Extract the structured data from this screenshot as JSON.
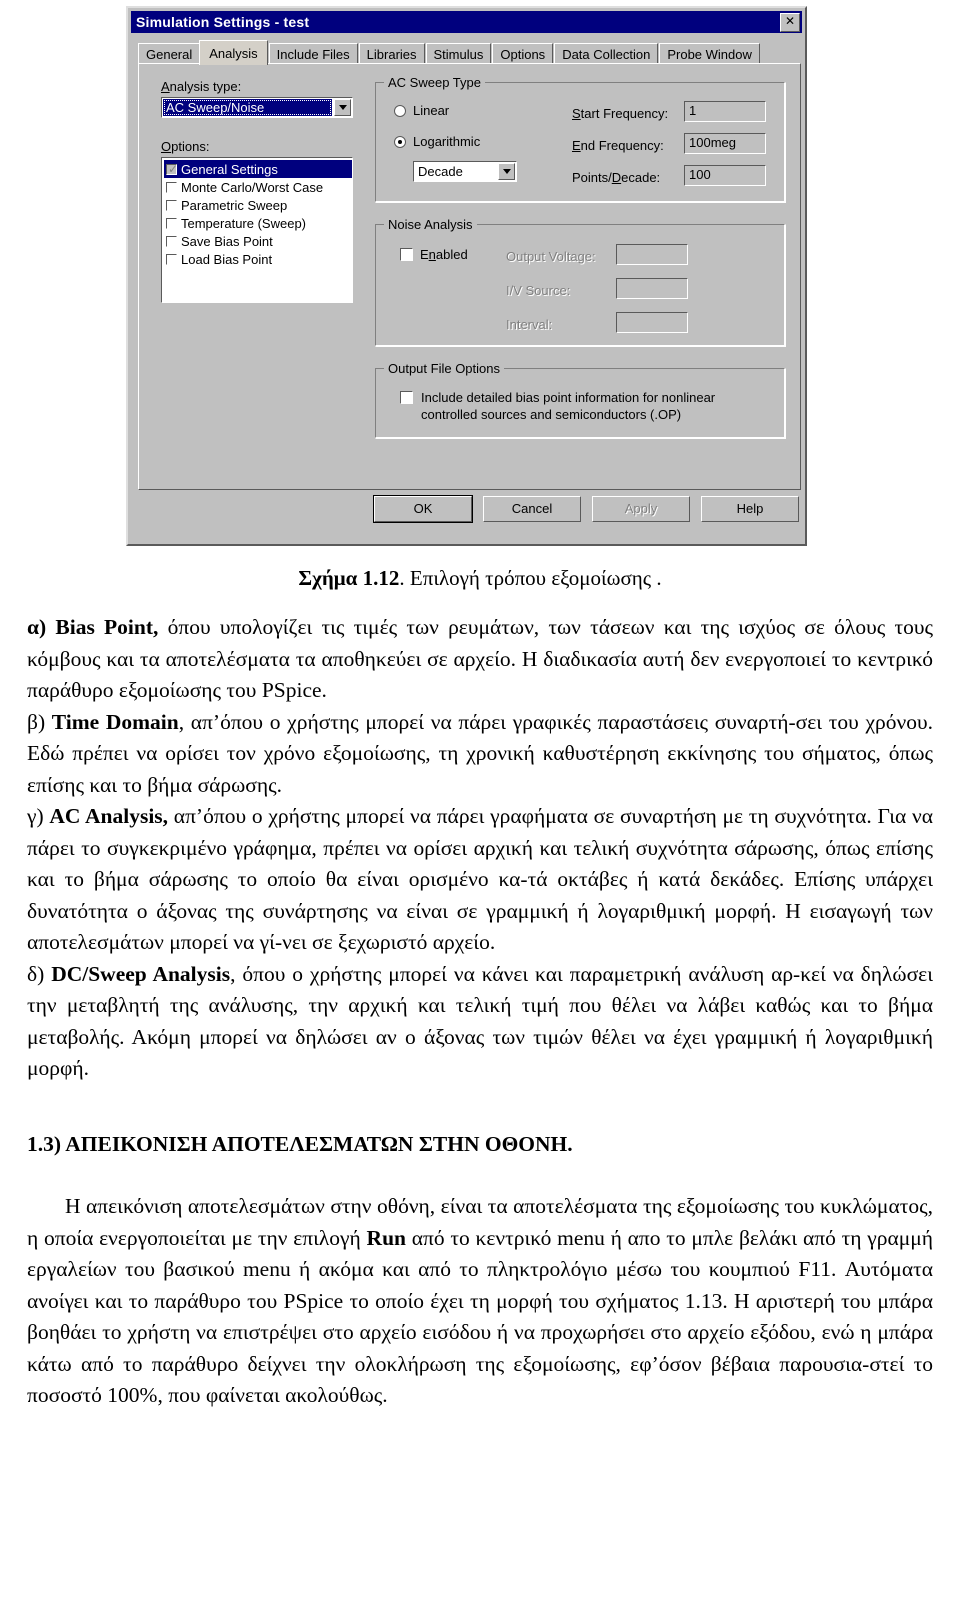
{
  "dialog": {
    "title": "Simulation Settings - test",
    "close_label": "✕",
    "tabs": [
      {
        "label": "General",
        "active": false
      },
      {
        "label": "Analysis",
        "active": true
      },
      {
        "label": "Include Files",
        "active": false
      },
      {
        "label": "Libraries",
        "active": false
      },
      {
        "label": "Stimulus",
        "active": false
      },
      {
        "label": "Options",
        "active": false
      },
      {
        "label": "Data Collection",
        "active": false
      },
      {
        "label": "Probe Window",
        "active": false
      }
    ],
    "analysis_type_label": "Analysis type:",
    "analysis_type_value": "AC Sweep/Noise",
    "options_label": "Options:",
    "options": [
      {
        "label": "General Settings",
        "checked": true,
        "selected": true
      },
      {
        "label": "Monte Carlo/Worst Case",
        "checked": false,
        "selected": false
      },
      {
        "label": "Parametric Sweep",
        "checked": false,
        "selected": false
      },
      {
        "label": "Temperature (Sweep)",
        "checked": false,
        "selected": false
      },
      {
        "label": "Save Bias Point",
        "checked": false,
        "selected": false
      },
      {
        "label": "Load Bias Point",
        "checked": false,
        "selected": false
      }
    ],
    "ac_sweep": {
      "group_title": "AC Sweep Type",
      "linear_label": "Linear",
      "logarithmic_label": "Logarithmic",
      "scale_value": "Decade",
      "start_freq_label": "Start Frequency:",
      "start_freq_value": "1",
      "end_freq_label": "End Frequency:",
      "end_freq_value": "100meg",
      "points_label": "Points/Decade:",
      "points_value": "100"
    },
    "noise": {
      "group_title": "Noise Analysis",
      "enabled_label": "Enabled",
      "output_voltage_label": "Output Voltage:",
      "output_voltage_value": "",
      "iv_source_label": "I/V Source:",
      "iv_source_value": "",
      "interval_label": "Interval:",
      "interval_value": ""
    },
    "output_file": {
      "group_title": "Output File Options",
      "include_label": "Include detailed bias point information for nonlinear controlled sources and semiconductors (.OP)"
    },
    "buttons": [
      {
        "label": "OK",
        "state": "default"
      },
      {
        "label": "Cancel",
        "state": "normal"
      },
      {
        "label": "Apply",
        "state": "disabled"
      },
      {
        "label": "Help",
        "state": "normal"
      }
    ]
  },
  "document": {
    "figure_caption_bold": "Σχήμα 1.12",
    "figure_caption_rest": ". Επιλογή τρόπου εξομοίωσης .",
    "para_a_bold": "α) Bias Point,",
    "para_a_rest": " όπου υπολογίζει τις  τιμές των ρευμάτων, των τάσεων και της ισχύος σε όλους τους κόμβους και τα αποτελέσματα τα αποθηκεύει σε αρχείο. Η διαδικασία αυτή δεν ενεργοποιεί το κεντρικό παράθυρο εξομοίωσης του PSpice.",
    "para_b_prefix": "β) ",
    "para_b_bold": "Time Domain",
    "para_b_rest": ", απ’όπου ο χρήστης μπορεί να πάρει  γραφικές  παραστάσεις συναρτή-σει του χρόνου. Εδώ πρέπει να ορίσει τον χρόνο εξομοίωσης, τη χρονική καθυστέρηση εκκίνησης του σήματος, όπως επίσης και το βήμα σάρωσης.",
    "para_c_prefix": "γ) ",
    "para_c_bold": "AC Analysis,",
    "para_c_rest": " απ’όπου ο χρήστης μπορεί να πάρει γραφήματα σε συναρτήση με τη συχνότητα. Για να πάρει το συγκεκριμένο γράφημα, πρέπει  να ορίσει αρχική και τελική συχνότητα σάρωσης, όπως επίσης και το βήμα σάρωσης το οποίο θα είναι ορισμένο κα-τά οκτάβες ή κατά δεκάδες. Επίσης υπάρχει δυνατότητα ο άξονας της συνάρτησης  να είναι σε γραμμική ή λογαριθμική μορφή. Η εισαγωγή των αποτελεσμάτων  μπορεί να γί-νει σε ξεχωριστό αρχείο.",
    "para_d_prefix": "δ) ",
    "para_d_bold": "DC/Sweep Analysis",
    "para_d_rest": ", όπου ο χρήστης μπορεί να κάνει και παραμετρική ανάλυση αρ-κεί να δηλώσει την μεταβλητή της ανάλυσης, την αρχική και τελική τιμή που θέλει να λάβει καθώς και το βήμα μεταβολής. Ακόμη μπορεί να δηλώσει αν ο άξονας των τιμών θέλει να έχει γραμμική ή λογαριθμική μορφή.",
    "section_heading": "1.3) ΑΠΕΙΚΟΝΙΣΗ ΑΠΟΤΕΛΕΣΜΑΤΩΝ ΣΤΗΝ ΟΘΟΝΗ.",
    "para_e_1": "Η  απεικόνιση  αποτελεσμάτων  στην  οθόνη,  είναι  τα  αποτελέσματα  της εξομοίωσης  του κυκλώματος, η οποία ενεργοποιείται με την επιλογή  ",
    "para_e_run": "Run",
    "para_e_2": " από το κεντρικό menu ή απο το μπλε βελάκι από τη γραμμή εργαλείων του βασικού menu ή ακόμα και από το πληκτρολόγιο μέσω του κουμπιού F11. Αυτόματα ανοίγει και το παράθυρο του PSpice το οποίο έχει τη μορφή του σχήματος 1.13. Η αριστερή του μπάρα βοηθάει το χρήστη να επιστρέψει στο αρχείο εισόδου ή να προχωρήσει στο αρχείο εξόδου, ενώ η μπάρα κάτω από το παράθυρο δείχνει την ολοκλήρωση της εξομοίωσης, εφ’όσον βέβαια παρουσια-στεί το ποσοστό 100%, που φαίνεται ακολούθως."
  }
}
